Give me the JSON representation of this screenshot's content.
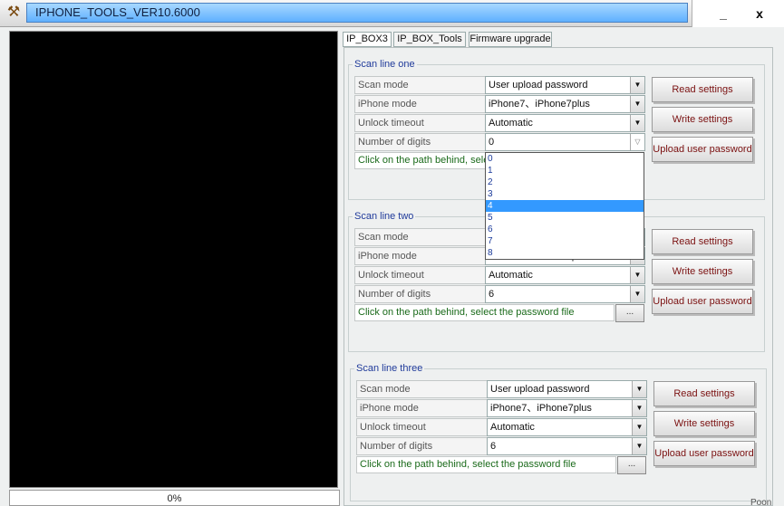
{
  "window": {
    "title": "IPHONE_TOOLS_VER10.6000",
    "minimize": "_",
    "close": "x",
    "app_icon": "hammer-wrench-icon"
  },
  "console": {
    "progress_text": "0%"
  },
  "tabs": [
    "IP_BOX3",
    "IP_BOX_Tools",
    "Firmware upgrade"
  ],
  "labels": {
    "scan_mode": "Scan mode",
    "iphone_mode": "iPhone mode",
    "unlock_timeout": "Unlock timeout",
    "number_of_digits": "Number of digits"
  },
  "buttons": {
    "read": "Read settings",
    "write": "Write settings",
    "upload": "Upload user password",
    "browse": "..."
  },
  "groups": [
    {
      "title": "Scan line one",
      "scan_mode": "User upload password",
      "iphone_mode": "iPhone7、iPhone7plus",
      "unlock_timeout": "Automatic",
      "number_of_digits": "0",
      "path_hint": "Click on the path behind, select"
    },
    {
      "title": "Scan line two",
      "scan_mode": "",
      "iphone_mode": "iPhone7、iPhone7plus",
      "unlock_timeout": "Automatic",
      "number_of_digits": "6",
      "path_hint": "Click on the path behind, select the password file"
    },
    {
      "title": "Scan line three",
      "scan_mode": "User upload password",
      "iphone_mode": "iPhone7、iPhone7plus",
      "unlock_timeout": "Automatic",
      "number_of_digits": "6",
      "path_hint": "Click on the path behind, select the password file"
    }
  ],
  "dropdown": {
    "options": [
      "0",
      "1",
      "2",
      "3",
      "4",
      "5",
      "6",
      "7",
      "8"
    ],
    "highlighted": "4"
  },
  "footer_partial": "Poon",
  "colors": {
    "title_bar": "#5fb0ff",
    "group_title": "#1f3a9a",
    "button_text": "#7a1010",
    "hint_text": "#1a6a1a",
    "selection": "#3399ff"
  }
}
